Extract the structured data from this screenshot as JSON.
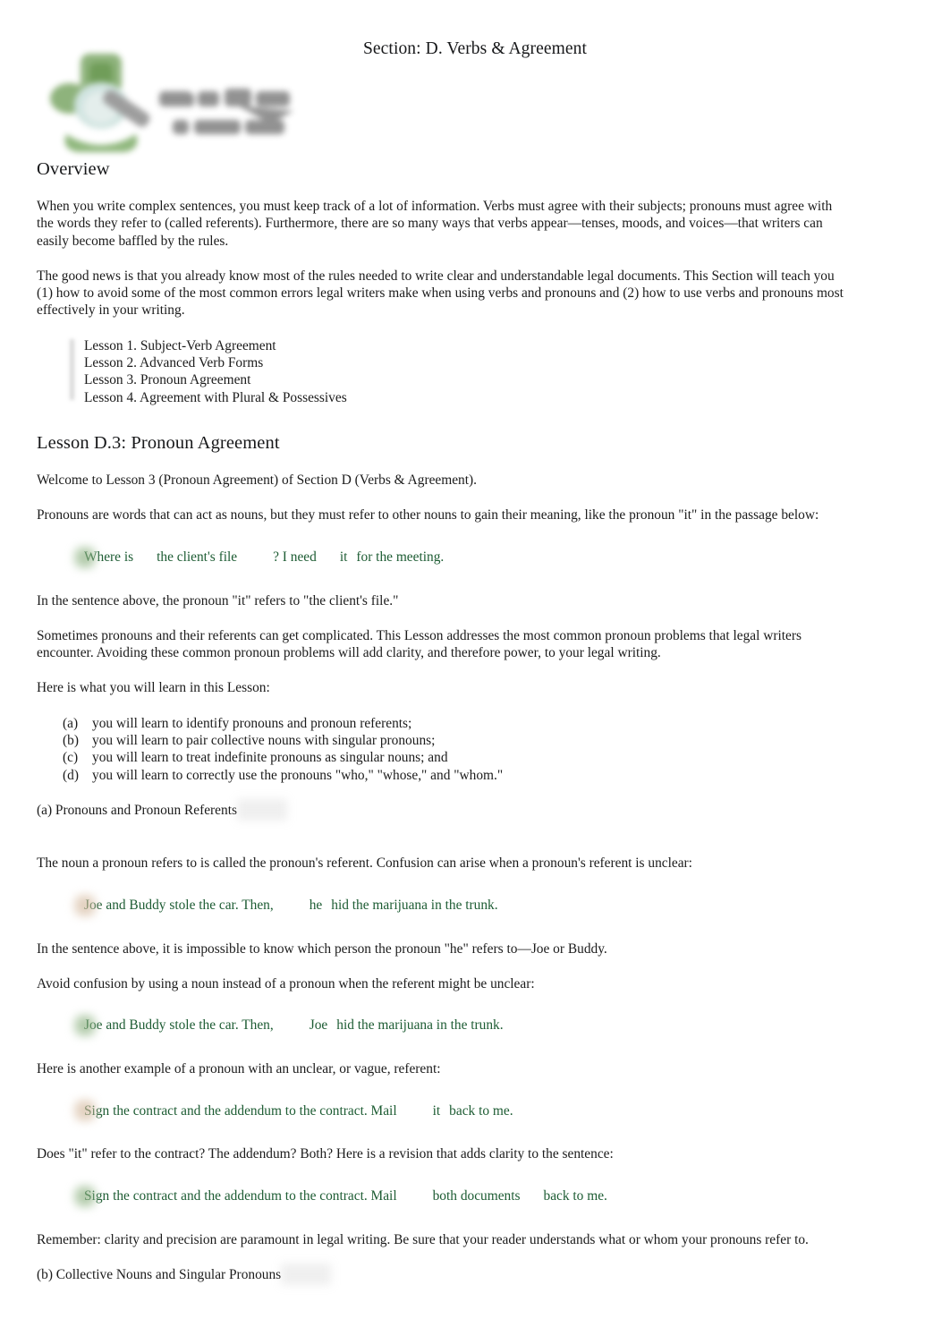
{
  "header": {
    "title": "Section: D. Verbs & Agreement",
    "logo_alt": "gavel-logo",
    "logo_green": "#7aa864",
    "logo_gray": "#8b8b8b"
  },
  "colors": {
    "body_text": "#1b1b1b",
    "example_green": "#1d5c33",
    "rule_gray": "#9a9a9a"
  },
  "overview": {
    "heading": "Overview",
    "paragraphs": [
      "When you write complex sentences, you must keep track of a lot of information. Verbs must agree with their subjects; pronouns must agree with the words they refer to (called referents). Furthermore, there are so many ways that verbs appear—tenses, moods, and voices—that writers can easily become baffled by the rules.",
      "The good news is that you already know most of the rules needed to write clear and understandable legal documents. This Section will teach you (1) how to avoid some of the most common errors legal writers make when using verbs and pronouns and (2) how to use verbs and pronouns most effectively in your writing."
    ],
    "lessons": [
      "Lesson 1. Subject-Verb Agreement",
      "Lesson 2. Advanced Verb Forms",
      "Lesson 3. Pronoun Agreement",
      "Lesson 4. Agreement with Plural & Possessives"
    ]
  },
  "lesson": {
    "heading": "Lesson D.3: Pronoun Agreement",
    "welcome": "Welcome to Lesson 3 (Pronoun Agreement) of Section D (Verbs & Agreement).",
    "intro": "Pronouns are words that can act as nouns, but they must refer to other nouns to gain their meaning, like the pronoun \"it\" in the passage below:",
    "example_1": {
      "icon": "correct-marker",
      "part_a": "Where is",
      "part_b": "the client's file",
      "part_c": "? I need",
      "part_d": "it",
      "part_e": "for the meeting."
    },
    "after_example_1": "In the sentence above, the pronoun \"it\" refers to \"the client's file.\"",
    "complications": "Sometimes pronouns and their referents can get complicated. This Lesson addresses the most common pronoun problems that legal writers encounter. Avoiding these common pronoun problems will add clarity, and therefore power, to your legal writing.",
    "learn_intro": "Here is what you will learn in this Lesson:",
    "objectives": [
      {
        "tag": "(a)",
        "text": "you will learn to identify pronouns and pronoun referents;"
      },
      {
        "tag": "(b)",
        "text": "you will learn to pair collective nouns with singular pronouns;"
      },
      {
        "tag": "(c)",
        "text": "you will learn to treat indefinite pronouns as singular nouns; and"
      },
      {
        "tag": "(d)",
        "text": "you will learn to correctly use the pronouns \"who,\" \"whose,\" and \"whom.\""
      }
    ]
  },
  "section_a": {
    "heading": "(a) Pronouns and Pronoun Referents",
    "para_1": "The noun a pronoun refers to is called the pronoun's referent. Confusion can arise when a pronoun's referent is unclear:",
    "example_unclear": {
      "icon": "incorrect-marker",
      "part_a": "Joe and Buddy stole the car. Then,",
      "part_b": "he",
      "part_c": "hid the marijuana in the trunk."
    },
    "para_2": "In the sentence above, it is impossible to know which person the pronoun \"he\" refers to—Joe or Buddy.",
    "para_3": "Avoid confusion by using a noun instead of a pronoun when the referent might be unclear:",
    "example_clear": {
      "icon": "correct-marker",
      "part_a": "Joe and Buddy stole the car. Then,",
      "part_b": "Joe",
      "part_c": "hid the marijuana in the trunk."
    },
    "para_4": "Here is another example of a pronoun with an unclear, or vague, referent:",
    "example_vague": {
      "icon": "incorrect-marker",
      "part_a": "Sign the contract and the addendum to the contract. Mail",
      "part_b": "it",
      "part_c": "back to me."
    },
    "para_5": "Does \"it\" refer to the contract? The addendum? Both? Here is a revision that adds clarity to the sentence:",
    "example_revised": {
      "icon": "correct-marker",
      "part_a": "Sign the contract and the addendum to the contract. Mail",
      "part_b": "both documents",
      "part_c": "back to me."
    },
    "para_6": "Remember: clarity and precision are paramount in legal writing. Be sure that your reader understands what or whom your pronouns refer to."
  },
  "section_b": {
    "heading": "(b) Collective Nouns and Singular Pronouns"
  }
}
